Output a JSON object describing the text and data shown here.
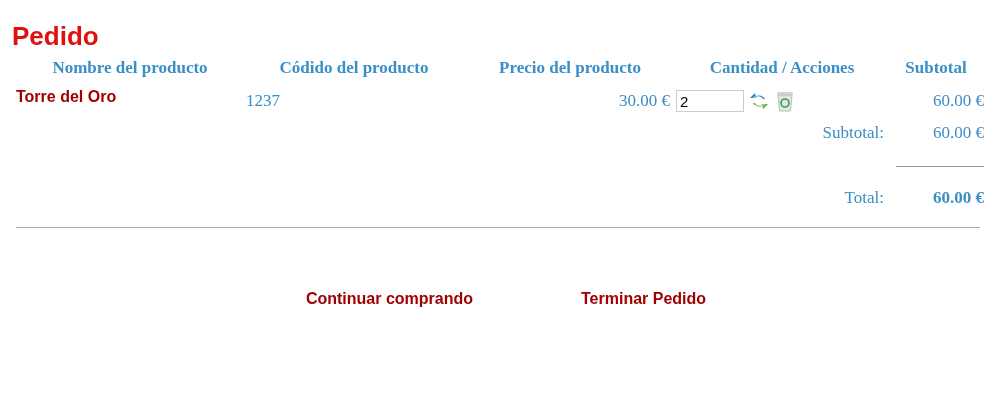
{
  "title": "Pedido",
  "table": {
    "columns": [
      "Nombre del producto",
      "Códido del producto",
      "Precio del producto",
      "Cantidad / Acciones",
      "Subtotal"
    ],
    "rows": [
      {
        "name": "Torre del Oro",
        "code": "1237",
        "price": "30.00 €",
        "quantity": "2",
        "subtotal": "60.00 €"
      }
    ]
  },
  "subtotal": {
    "label": "Subtotal:",
    "value": "60.00 €"
  },
  "total": {
    "label": "Total:",
    "value": "60.00 €"
  },
  "links": [
    "Continuar comprando",
    "Terminar Pedido"
  ]
}
